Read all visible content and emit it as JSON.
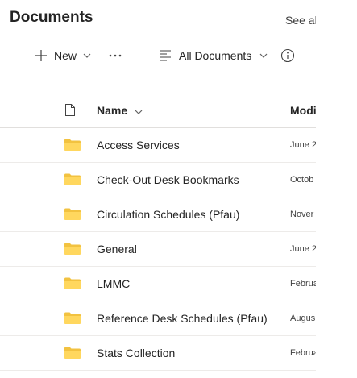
{
  "library": {
    "title": "Documents",
    "see_all": "See all"
  },
  "toolbar": {
    "new_label": "New",
    "more_icon": "ellipsis-icon",
    "view_label": "All Documents",
    "info_icon": "info-icon"
  },
  "columns": {
    "name": "Name",
    "modified": "Modi"
  },
  "files": [
    {
      "name": "Access Services",
      "modified": "June 2",
      "type": "folder"
    },
    {
      "name": "Check-Out Desk Bookmarks",
      "modified": "Octob",
      "type": "folder"
    },
    {
      "name": "Circulation Schedules (Pfau)",
      "modified": "Nover",
      "type": "folder"
    },
    {
      "name": "General",
      "modified": "June 2",
      "type": "folder"
    },
    {
      "name": "LMMC",
      "modified": "Februa",
      "type": "folder"
    },
    {
      "name": "Reference Desk Schedules (Pfau)",
      "modified": "Augus",
      "type": "folder"
    },
    {
      "name": "Stats Collection",
      "modified": "Februa",
      "type": "folder"
    }
  ],
  "colors": {
    "folder": "#ffd75e",
    "folder_back": "#f2c240",
    "divider": "#edebe9"
  }
}
